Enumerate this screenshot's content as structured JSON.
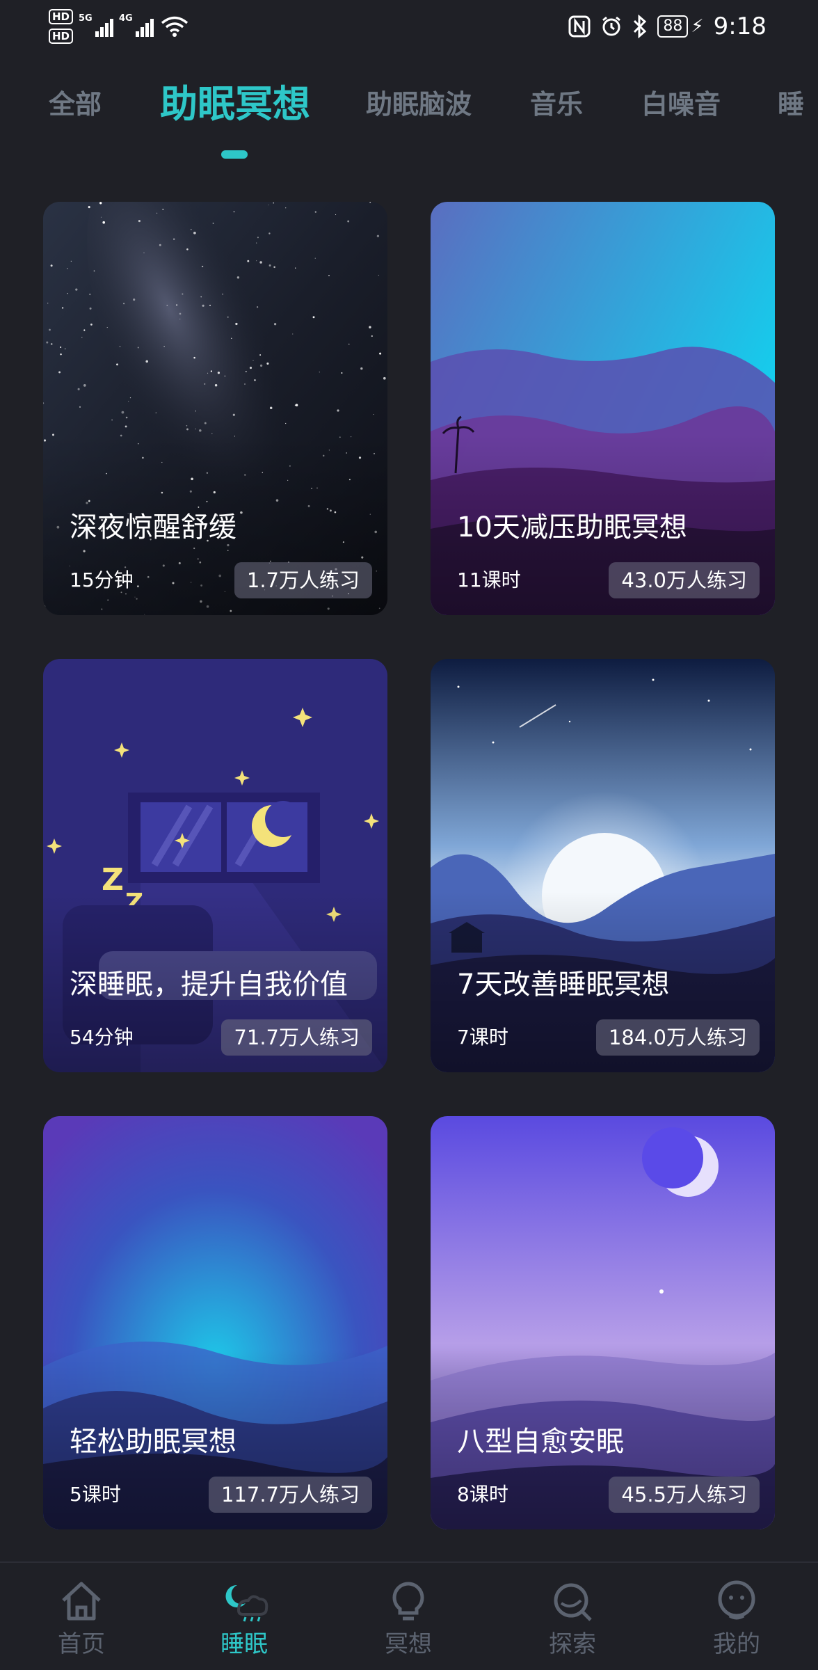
{
  "status_bar": {
    "hd1": "HD",
    "hd2": "HD",
    "net1": "5G",
    "net2": "4G",
    "battery": "88",
    "time": "9:18"
  },
  "tabs": [
    {
      "label": "全部"
    },
    {
      "label": "助眠冥想",
      "active": true
    },
    {
      "label": "助眠脑波"
    },
    {
      "label": "音乐"
    },
    {
      "label": "白噪音"
    },
    {
      "label": "睡"
    }
  ],
  "cards": [
    {
      "title": "深夜惊醒舒缓",
      "meta": "15分钟",
      "count": "1.7万人练习"
    },
    {
      "title": "10天减压助眠冥想",
      "meta": "11课时",
      "count": "43.0万人练习"
    },
    {
      "title": "深睡眠，提升自我价值",
      "meta": "54分钟",
      "count": "71.7万人练习"
    },
    {
      "title": "7天改善睡眠冥想",
      "meta": "7课时",
      "count": "184.0万人练习"
    },
    {
      "title": "轻松助眠冥想",
      "meta": "5课时",
      "count": "117.7万人练习"
    },
    {
      "title": "八型自愈安眠",
      "meta": "8课时",
      "count": "45.5万人练习"
    }
  ],
  "bottom_nav": [
    {
      "label": "首页",
      "icon": "home-icon"
    },
    {
      "label": "睡眠",
      "icon": "sleep-moon-icon",
      "active": true
    },
    {
      "label": "冥想",
      "icon": "meditation-bulb-icon"
    },
    {
      "label": "探索",
      "icon": "explore-icon"
    },
    {
      "label": "我的",
      "icon": "profile-face-icon"
    }
  ],
  "colors": {
    "background": "#1f2026",
    "accent": "#2ec7c8",
    "inactive_tab": "#6f7884",
    "inactive_nav": "#5c6370"
  }
}
